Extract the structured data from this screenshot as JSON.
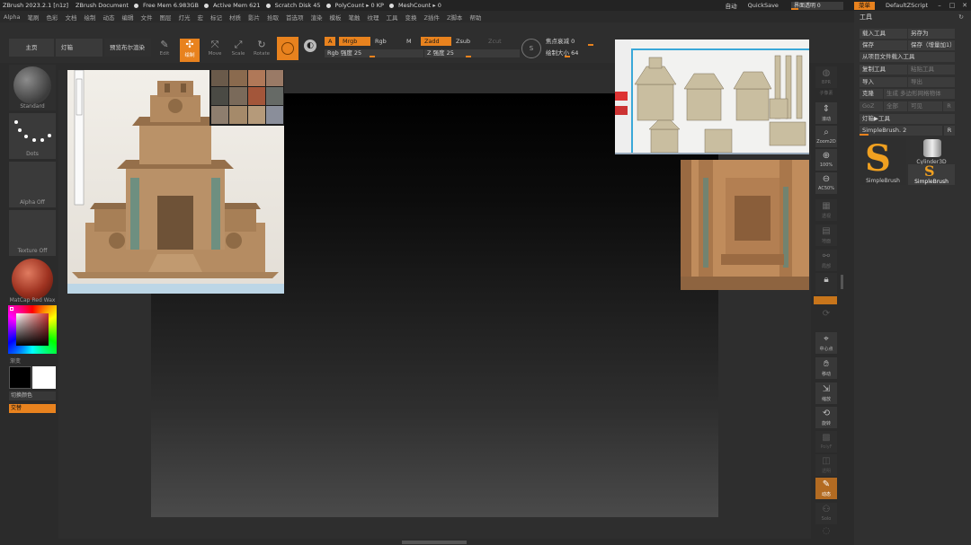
{
  "titlebar": {
    "app": "ZBrush 2023.2.1 [n1z]",
    "doc": "ZBrush Document",
    "free_mem": "Free Mem 6.983GB",
    "active_mem": "Active Mem 621",
    "scratch": "Scratch Disk 45",
    "polycount": "PolyCount ▸ 0 KP",
    "meshcount": "MeshCount ▸ 0",
    "ai_label": "自动",
    "quicksave": "QuickSave",
    "transparency": "界面透明 0",
    "menu": "菜单",
    "script": "DefaultZScript"
  },
  "menus": [
    "Alpha",
    "笔刷",
    "色彩",
    "文档",
    "绘制",
    "动态",
    "编辑",
    "文件",
    "图层",
    "灯光",
    "宏",
    "标记",
    "材质",
    "影片",
    "拾取",
    "首选项",
    "渲染",
    "模板",
    "笔触",
    "纹理",
    "工具",
    "变换",
    "Z插件",
    "Z脚本",
    "帮助"
  ],
  "shelf": {
    "home": "主页",
    "lightbox": "灯箱",
    "bpr": "预览布尔渲染",
    "edit": "Edit",
    "draw": "绘制",
    "move": "Move",
    "scale": "Scale",
    "rotate": "Rotate",
    "a": "A",
    "mrgb": "Mrgb",
    "rgb": "Rgb",
    "m": "M",
    "zadd": "Zadd",
    "zsub": "Zsub",
    "zcut": "Zcut",
    "rgb_intensity": "Rgb 强度 25",
    "z_intensity": "Z 强度 25",
    "focal_shift": "焦点衰减 0",
    "draw_size": "绘制大小 64"
  },
  "left": {
    "standard": "Standard",
    "dots": "Dots",
    "alpha_off": "Alpha Off",
    "texture_off": "Texture Off",
    "matcap": "MatCap Red Wax",
    "gradient": "渐变",
    "switch_color": "切换颜色",
    "alternate": "交替"
  },
  "right": {
    "bpr": "BPR",
    "subpix": "子像素",
    "scroll": "滚动",
    "zoom2d": "Zoom2D",
    "z100": "100%",
    "ac50": "AC50%",
    "persp": "透视",
    "floor": "地面",
    "local": "局部",
    "frame": "中心点",
    "move": "移动",
    "scale": "缩放",
    "rotate": "旋转",
    "polyf": "PolyF",
    "transp": "透明",
    "dynamic": "动态",
    "solo": "Solo"
  },
  "tool": {
    "title": "工具",
    "load": "载入工具",
    "save_as": "另存为",
    "save": "保存",
    "save_inc": "保存（增量加1）",
    "load_from_project": "从项目文件载入工具",
    "copy": "复制工具",
    "paste": "粘贴工具",
    "import": "导入",
    "export": "导出",
    "clone": "克隆",
    "make_polymesh": "生成 多边形网格物体",
    "goz": "GoZ",
    "all": "全部",
    "visible": "可见",
    "r": "R",
    "lightbox_tools": "灯箱▶工具",
    "simplebrush": "SimpleBrush. 2",
    "thumb1": "SimpleBrush",
    "thumb2": "Cylinder3D",
    "thumb3": "SimpleBrush"
  }
}
